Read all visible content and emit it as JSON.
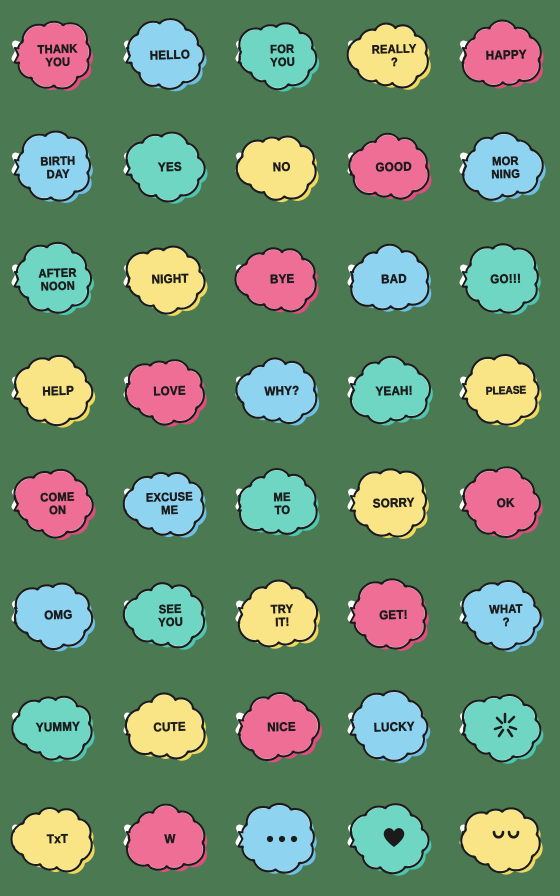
{
  "page": {
    "background_color": "#4b7a52",
    "title": "Speech bubble emoji sticker sheet",
    "columns": 5,
    "rows": 8
  },
  "palette": {
    "pink": "#ef6e96",
    "pink_shadow": "#e24d7d",
    "blue": "#8ed3f0",
    "blue_shadow": "#6ec0e6",
    "mint": "#6ed6c3",
    "mint_shadow": "#4ec6b2",
    "yellow": "#f9e585",
    "yellow_shadow": "#f2d95e",
    "outline": "#1b1b1b",
    "rim": "#ffffff"
  },
  "stickers": [
    {
      "id": "thank-you",
      "text": "THANK\nYOU",
      "lines": 2,
      "color": "pink",
      "kind": "text"
    },
    {
      "id": "hello",
      "text": "HELLO",
      "lines": 1,
      "color": "blue",
      "kind": "text"
    },
    {
      "id": "for-you",
      "text": "FOR\nYOU",
      "lines": 2,
      "color": "mint",
      "kind": "text"
    },
    {
      "id": "really",
      "text": "REALLY\n?",
      "lines": 2,
      "color": "yellow",
      "kind": "text"
    },
    {
      "id": "happy",
      "text": "HAPPY",
      "lines": 1,
      "color": "pink",
      "kind": "text"
    },
    {
      "id": "birthday",
      "text": "BIRTH\nDAY",
      "lines": 2,
      "color": "blue",
      "kind": "text"
    },
    {
      "id": "yes",
      "text": "YES",
      "lines": 1,
      "color": "mint",
      "kind": "text"
    },
    {
      "id": "no",
      "text": "NO",
      "lines": 1,
      "color": "yellow",
      "kind": "text"
    },
    {
      "id": "good",
      "text": "GOOD",
      "lines": 1,
      "color": "pink",
      "kind": "text"
    },
    {
      "id": "morning",
      "text": "MOR\nNING",
      "lines": 2,
      "color": "blue",
      "kind": "text"
    },
    {
      "id": "afternoon",
      "text": "AFTER\nNOON",
      "lines": 2,
      "color": "mint",
      "kind": "text"
    },
    {
      "id": "night",
      "text": "NIGHT",
      "lines": 1,
      "color": "yellow",
      "kind": "text"
    },
    {
      "id": "bye",
      "text": "BYE",
      "lines": 1,
      "color": "pink",
      "kind": "text"
    },
    {
      "id": "bad",
      "text": "BAD",
      "lines": 1,
      "color": "blue",
      "kind": "text"
    },
    {
      "id": "go",
      "text": "GO!!!",
      "lines": 1,
      "color": "mint",
      "kind": "text"
    },
    {
      "id": "help",
      "text": "HELP",
      "lines": 1,
      "color": "yellow",
      "kind": "text"
    },
    {
      "id": "love",
      "text": "LOVE",
      "lines": 1,
      "color": "pink",
      "kind": "text"
    },
    {
      "id": "why",
      "text": "WHY?",
      "lines": 1,
      "color": "blue",
      "kind": "text"
    },
    {
      "id": "yeah",
      "text": "YEAH!",
      "lines": 1,
      "color": "mint",
      "kind": "text"
    },
    {
      "id": "please",
      "text": "PLEASE",
      "lines": 1,
      "color": "yellow",
      "kind": "text"
    },
    {
      "id": "come-on",
      "text": "COME\nON",
      "lines": 2,
      "color": "pink",
      "kind": "text"
    },
    {
      "id": "excuse-me",
      "text": "EXCUSE\nME",
      "lines": 2,
      "color": "blue",
      "kind": "text"
    },
    {
      "id": "me-to",
      "text": "ME\nTO",
      "lines": 2,
      "color": "mint",
      "kind": "text"
    },
    {
      "id": "sorry",
      "text": "SORRY",
      "lines": 1,
      "color": "yellow",
      "kind": "text"
    },
    {
      "id": "ok",
      "text": "OK",
      "lines": 1,
      "color": "pink",
      "kind": "text"
    },
    {
      "id": "omg",
      "text": "OMG",
      "lines": 1,
      "color": "blue",
      "kind": "text"
    },
    {
      "id": "see-you",
      "text": "SEE\nYOU",
      "lines": 2,
      "color": "mint",
      "kind": "text"
    },
    {
      "id": "try-it",
      "text": "TRY\nIT!",
      "lines": 2,
      "color": "yellow",
      "kind": "text"
    },
    {
      "id": "get",
      "text": "GET!",
      "lines": 1,
      "color": "pink",
      "kind": "text"
    },
    {
      "id": "what",
      "text": "WHAT\n?",
      "lines": 2,
      "color": "blue",
      "kind": "text"
    },
    {
      "id": "yummy",
      "text": "YUMMY",
      "lines": 1,
      "color": "mint",
      "kind": "text"
    },
    {
      "id": "cute",
      "text": "CUTE",
      "lines": 1,
      "color": "yellow",
      "kind": "text"
    },
    {
      "id": "nice",
      "text": "NICE",
      "lines": 1,
      "color": "pink",
      "kind": "text"
    },
    {
      "id": "lucky",
      "text": "LUCKY",
      "lines": 1,
      "color": "blue",
      "kind": "text"
    },
    {
      "id": "anger-mark",
      "text": "",
      "lines": 0,
      "color": "mint",
      "kind": "anger-icon"
    },
    {
      "id": "txt-face",
      "text": "TxT",
      "lines": 1,
      "color": "yellow",
      "kind": "text"
    },
    {
      "id": "w-letter",
      "text": "W",
      "lines": 1,
      "color": "pink",
      "kind": "text"
    },
    {
      "id": "ellipsis",
      "text": "",
      "lines": 0,
      "color": "blue",
      "kind": "ellipsis-icon"
    },
    {
      "id": "heart",
      "text": "",
      "lines": 0,
      "color": "mint",
      "kind": "heart-icon"
    },
    {
      "id": "smile-face",
      "text": "",
      "lines": 0,
      "color": "yellow",
      "kind": "smile-icon"
    }
  ]
}
